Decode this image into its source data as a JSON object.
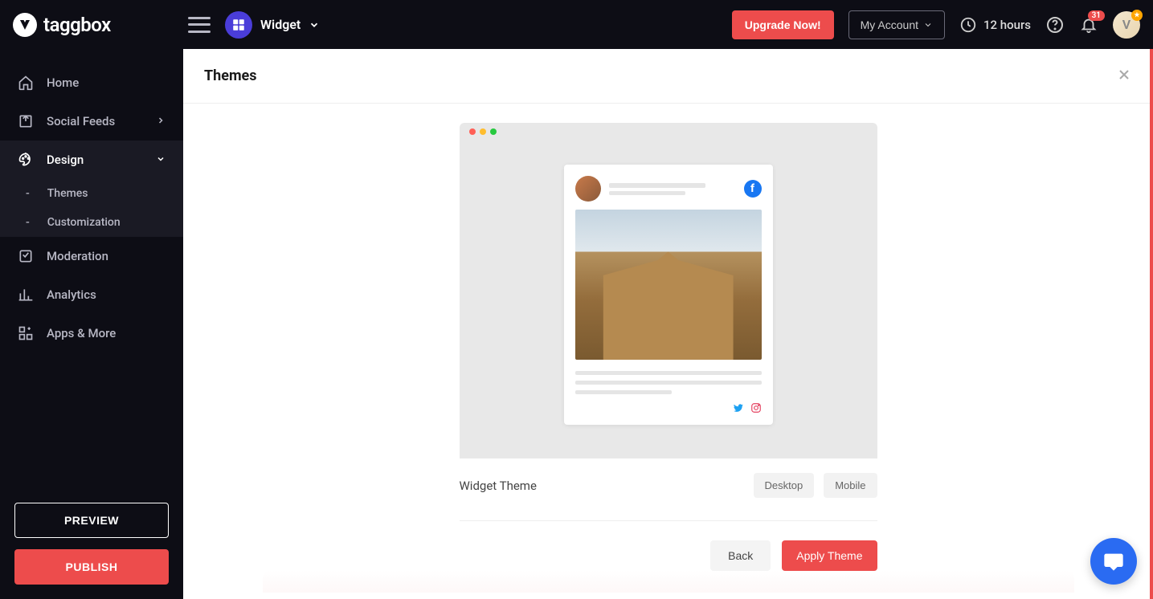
{
  "header": {
    "brand": "taggbox",
    "widget_label": "Widget",
    "upgrade_label": "Upgrade Now!",
    "account_label": "My Account",
    "time_text": "12 hours",
    "notification_count": "31",
    "avatar_letter": "V"
  },
  "sidebar": {
    "items": [
      {
        "label": "Home",
        "icon": "home"
      },
      {
        "label": "Social Feeds",
        "icon": "feed",
        "has_arrow": true
      },
      {
        "label": "Design",
        "icon": "design",
        "active": true,
        "expanded": true
      },
      {
        "label": "Moderation",
        "icon": "moderation"
      },
      {
        "label": "Analytics",
        "icon": "analytics"
      },
      {
        "label": "Apps & More",
        "icon": "apps"
      }
    ],
    "design_sub": [
      {
        "label": "Themes"
      },
      {
        "label": "Customization"
      }
    ],
    "preview_label": "PREVIEW",
    "publish_label": "PUBLISH"
  },
  "panel": {
    "title": "Themes",
    "theme_name": "Widget Theme",
    "tabs": {
      "desktop": "Desktop",
      "mobile": "Mobile"
    },
    "back_label": "Back",
    "apply_label": "Apply Theme"
  },
  "colors": {
    "accent": "#ed4c4c",
    "header_bg": "#0d0d15",
    "primary_blue": "#2a6bf2"
  }
}
